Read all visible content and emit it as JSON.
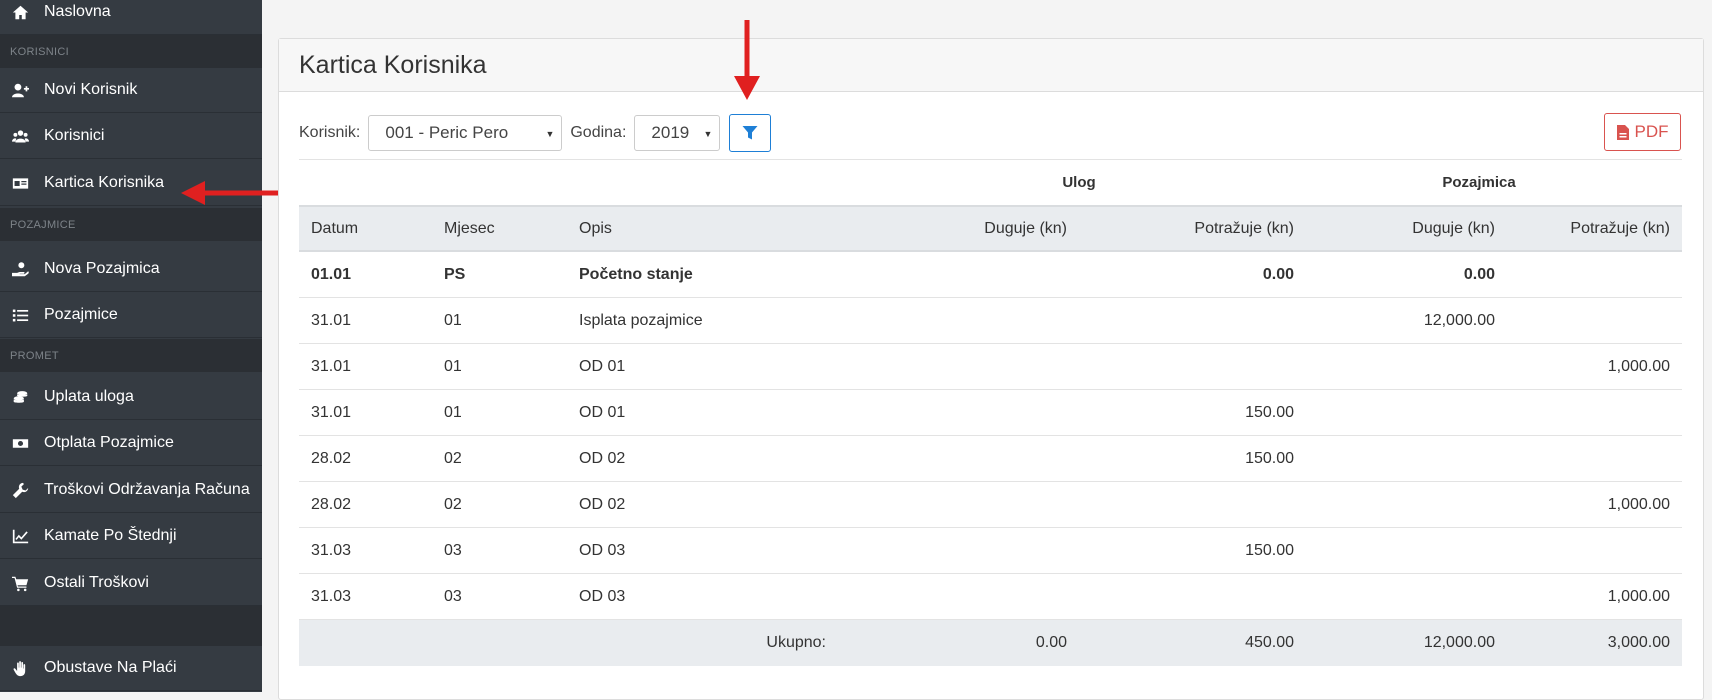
{
  "sidebar": {
    "top_item": {
      "label": "Naslovna",
      "icon": "home-icon"
    },
    "sections": [
      {
        "title": "KORISNICI"
      },
      {
        "title": "POZAJMICE"
      },
      {
        "title": "PROMET"
      }
    ],
    "items": [
      {
        "label": "Novi Korisnik",
        "icon": "user-plus-icon"
      },
      {
        "label": "Korisnici",
        "icon": "users-icon"
      },
      {
        "label": "Kartica Korisnika",
        "icon": "id-card-icon"
      },
      {
        "label": "Nova Pozajmica",
        "icon": "hand-coin-icon"
      },
      {
        "label": "Pozajmice",
        "icon": "list-icon"
      },
      {
        "label": "Uplata uloga",
        "icon": "coins-icon"
      },
      {
        "label": "Otplata Pozajmice",
        "icon": "money-bill-icon"
      },
      {
        "label": "Troškovi Održavanja Računa",
        "icon": "wrench-icon"
      },
      {
        "label": "Kamate Po Štednji",
        "icon": "chart-line-icon"
      },
      {
        "label": "Ostali Troškovi",
        "icon": "cart-icon"
      },
      {
        "label": "Obustave Na Plaći",
        "icon": "hand-icon"
      }
    ]
  },
  "card": {
    "title": "Kartica Korisnika",
    "filters": {
      "user_label": "Korisnik:",
      "user_value": "001 - Peric Pero",
      "year_label": "Godina:",
      "year_value": "2019"
    },
    "pdf_label": "PDF"
  },
  "table": {
    "group_headers": {
      "ulog": "Ulog",
      "pozajmica": "Pozajmica"
    },
    "columns": {
      "datum": "Datum",
      "mjesec": "Mjesec",
      "opis": "Opis",
      "ulog_duguje": "Duguje (kn)",
      "ulog_potrazuje": "Potražuje (kn)",
      "pozajmica_duguje": "Duguje (kn)",
      "pozajmica_potrazuje": "Potražuje (kn)"
    },
    "rows": [
      {
        "datum": "01.01",
        "mjesec": "PS",
        "opis": "Početno stanje",
        "ud": "",
        "up": "0.00",
        "pd": "0.00",
        "pp": "",
        "bold": true
      },
      {
        "datum": "31.01",
        "mjesec": "01",
        "opis": "Isplata pozajmice",
        "ud": "",
        "up": "",
        "pd": "12,000.00",
        "pp": ""
      },
      {
        "datum": "31.01",
        "mjesec": "01",
        "opis": "OD 01",
        "ud": "",
        "up": "",
        "pd": "",
        "pp": "1,000.00"
      },
      {
        "datum": "31.01",
        "mjesec": "01",
        "opis": "OD 01",
        "ud": "",
        "up": "150.00",
        "pd": "",
        "pp": ""
      },
      {
        "datum": "28.02",
        "mjesec": "02",
        "opis": "OD 02",
        "ud": "",
        "up": "150.00",
        "pd": "",
        "pp": ""
      },
      {
        "datum": "28.02",
        "mjesec": "02",
        "opis": "OD 02",
        "ud": "",
        "up": "",
        "pd": "",
        "pp": "1,000.00"
      },
      {
        "datum": "31.03",
        "mjesec": "03",
        "opis": "OD 03",
        "ud": "",
        "up": "150.00",
        "pd": "",
        "pp": ""
      },
      {
        "datum": "31.03",
        "mjesec": "03",
        "opis": "OD 03",
        "ud": "",
        "up": "",
        "pd": "",
        "pp": "1,000.00"
      }
    ],
    "total": {
      "label": "Ukupno:",
      "ud": "0.00",
      "up": "450.00",
      "pd": "12,000.00",
      "pp": "3,000.00"
    }
  },
  "colors": {
    "arrow": "#e02020",
    "accent": "#1e7fd6",
    "danger": "#d9534f"
  }
}
